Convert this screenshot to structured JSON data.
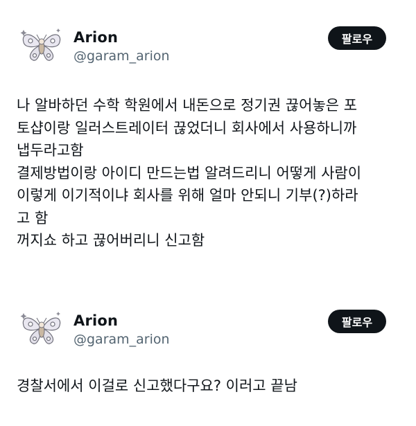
{
  "tweets": [
    {
      "user": {
        "name": "Arion",
        "handle": "@garam_arion"
      },
      "follow_label": "팔로우",
      "avatar_icon": "butterfly-avatar-icon",
      "lines": [
        "나 알바하던 수학 학원에서 내돈으로 정기권 끊어놓은 포",
        "토샵이랑 일러스트레이터 끊었더니 회사에서 사용하니까",
        "냅두라고함",
        "결제방법이랑 아이디 만드는법 알려드리니 어떻게 사람이",
        "이렇게 이기적이냐 회사를 위해 얼마 안되니 기부(?)하라",
        "고 함",
        "꺼지쇼 하고 끊어버리니 신고함"
      ]
    },
    {
      "user": {
        "name": "Arion",
        "handle": "@garam_arion"
      },
      "follow_label": "팔로우",
      "avatar_icon": "butterfly-avatar-icon",
      "lines": [
        "경찰서에서 이걸로 신고했다구요?  이러고 끝남"
      ]
    }
  ]
}
